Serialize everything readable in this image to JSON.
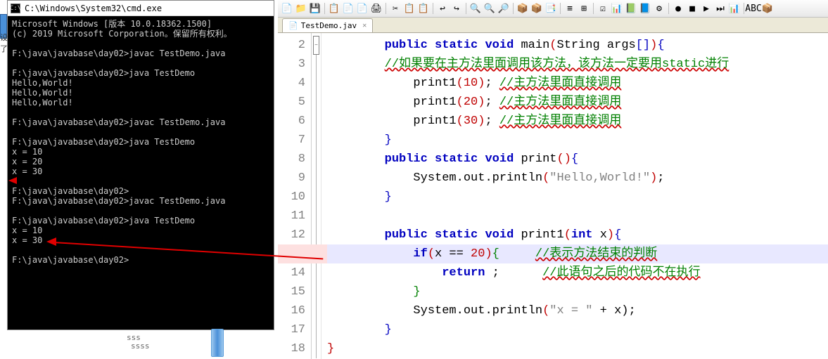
{
  "cmd": {
    "title": "C:\\Windows\\System32\\cmd.exe",
    "lines": "Microsoft Windows [版本 10.0.18362.1500]\n(c) 2019 Microsoft Corporation。保留所有权利。\n\nF:\\java\\javabase\\day02>javac TestDemo.java\n\nF:\\java\\javabase\\day02>java TestDemo\nHello,World!\nHello,World!\nHello,World!\n\nF:\\java\\javabase\\day02>javac TestDemo.java\n\nF:\\java\\javabase\\day02>java TestDemo\nx = 10\nx = 20\nx = 30\n\nF:\\java\\javabase\\day02>\nF:\\java\\javabase\\day02>javac TestDemo.java\n\nF:\\java\\javabase\\day02>java TestDemo\nx = 10\nx = 30\n\nF:\\java\\javabase\\day02>"
  },
  "btm": {
    "l1": "sss",
    "l2": "ssss"
  },
  "tab": {
    "name": "TestDemo.jav",
    "close": "✕"
  },
  "lineStart": 2,
  "code": {
    "l2": {
      "indent": "        ",
      "kw1": "public",
      "kw2": "static",
      "kw3": "void",
      "fn": "main",
      "sig": "(String args[]){"
    },
    "l3c": "//如果要在主方法里面调用该方法，该方法一定要用static进行",
    "l4": {
      "fn": "print1",
      "arg": "10",
      "cm": "//主方法里面直接调用"
    },
    "l5": {
      "fn": "print1",
      "arg": "20",
      "cm": "//主方法里面直接调用"
    },
    "l6": {
      "fn": "print1",
      "arg": "30",
      "cm": "//主方法里面直接调用"
    },
    "l7": "        }",
    "l8": {
      "kw1": "public",
      "kw2": "static",
      "kw3": "void",
      "fn": "print",
      "sig": "(){"
    },
    "l9": {
      "txt": "System.out.println",
      "str": "\"Hello,World!\""
    },
    "l10": "        }",
    "l12": {
      "kw1": "public",
      "kw2": "static",
      "kw3": "void",
      "fn": "print1",
      "sig": "(",
      "kw4": "int",
      "sig2": " x){"
    },
    "l13": {
      "kw": "if",
      "cond": "(x == 20){",
      "cm": "//表示方法结束的判断"
    },
    "l14": {
      "kw": "return",
      "rest": " ;",
      "cm": "//此语句之后的代码不在执行"
    },
    "l15": "            }",
    "l16": {
      "txt": "System.out.println",
      "str": "\"x = \"",
      "op": " + x);"
    },
    "l17": "        }",
    "l18": "}"
  },
  "toolbar_icons": [
    "📄",
    "📁",
    "💾",
    "📋",
    "📄",
    "📄",
    "🖨",
    "✂",
    "📋",
    "📋",
    "↩",
    "↪",
    "🔍",
    "🔍",
    "🔎",
    "📦",
    "📦",
    "📑",
    "≡",
    "⊞",
    "☑",
    "📊",
    "📗",
    "📘",
    "⚙",
    "●",
    "■",
    "▶",
    "⏭",
    "📊",
    "ABC",
    "📦"
  ]
}
